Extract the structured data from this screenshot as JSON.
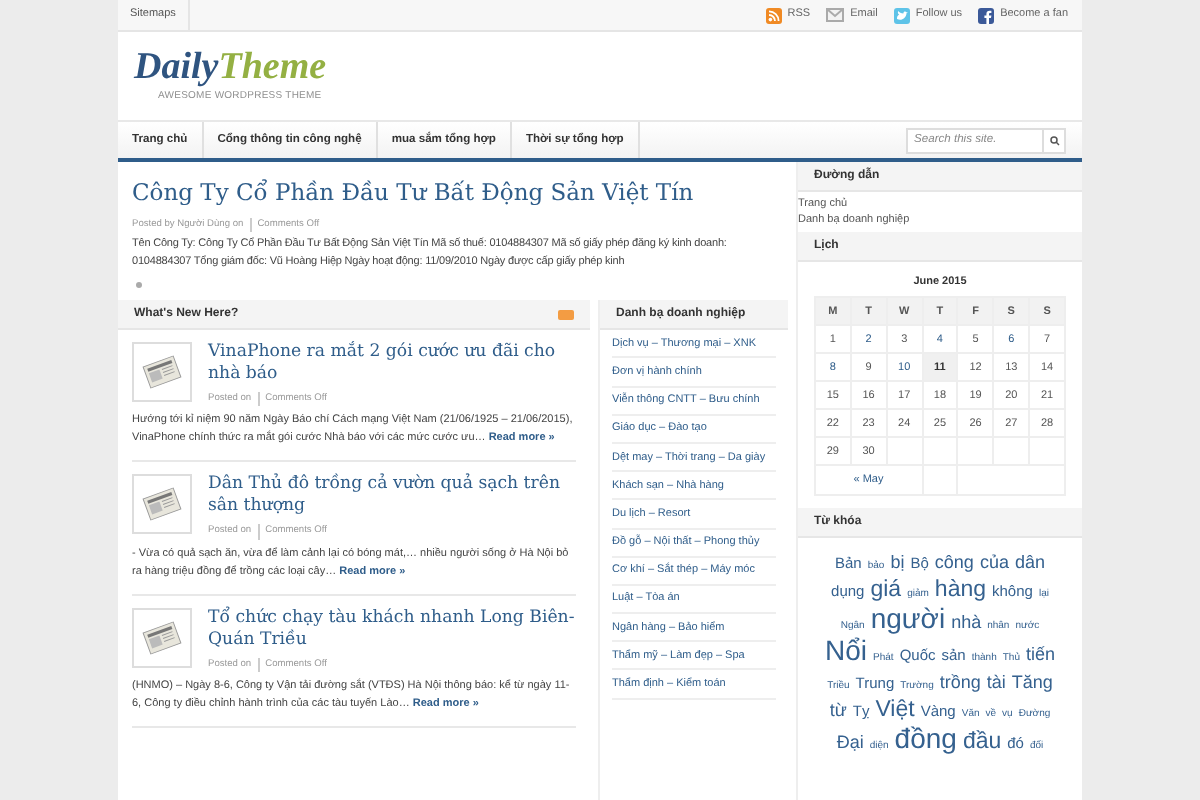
{
  "top_bar": {
    "sitemap": "Sitemaps",
    "social": [
      {
        "kind": "rss",
        "label": "RSS"
      },
      {
        "kind": "email",
        "label": "Email"
      },
      {
        "kind": "twitter",
        "label": "Follow us"
      },
      {
        "kind": "facebook",
        "label": "Become a fan"
      }
    ]
  },
  "logo": {
    "first": "Daily",
    "second": "Theme",
    "tagline": "AWESOME WORDPRESS THEME"
  },
  "nav": {
    "items": [
      "Trang chủ",
      "Cổng thông tin công nghệ",
      "mua sắm tổng hợp",
      "Thời sự tổng hợp"
    ],
    "search_placeholder": "Search this site."
  },
  "post": {
    "title": "Công Ty Cổ Phần Đầu Tư Bất Động Sản Việt Tín",
    "meta": [
      "Posted by Người Dùng on",
      "Comments Off"
    ],
    "body": "Tên Công Ty: Công Ty Cổ Phần Đầu Tư Bất Động Sản Việt Tín Mã số thuế:  0104884307   Mã số giấy phép đăng ký kinh doanh: 0104884307 Tổng giám đốc: Vũ Hoàng Hiệp Ngày hoạt động: 11/09/2010 Ngày được cấp giấy phép kinh"
  },
  "whats_new": {
    "title": "What's New Here?",
    "items": [
      {
        "title": "VinaPhone ra mắt 2 gói cước ưu đãi cho nhà báo",
        "meta": [
          "Posted on",
          "Comments Off"
        ],
        "excerpt": "Hướng tới kỉ niệm 90 năm Ngày Báo chí Cách mạng Việt Nam (21/06/1925 – 21/06/2015), VinaPhone chính thức ra mắt gói cước Nhà báo với các mức cước ưu…",
        "more": "Read more »"
      },
      {
        "title": "Dân Thủ đô trồng cả vườn quả sạch trên sân thượng",
        "meta": [
          "Posted on",
          "Comments Off"
        ],
        "excerpt": "- Vừa có quả sạch ăn, vừa để làm cảnh lại có bóng mát,… nhiều người sống ở Hà Nội bỏ ra hàng triệu đồng để trồng các loại cây…",
        "more": "Read more »"
      },
      {
        "title": "Tổ chức chạy tàu khách nhanh Long Biên-Quán Triều",
        "meta": [
          "Posted on",
          "Comments Off"
        ],
        "excerpt": "(HNMO) – Ngày 8-6, Công ty Vận tải đường sắt (VTĐS) Hà Nội thông báo: kể từ ngày 11-6, Công ty điều chỉnh hành trình của các tàu tuyến Lào…",
        "more": "Read more »"
      }
    ]
  },
  "directory": {
    "title": "Danh bạ doanh nghiệp",
    "items": [
      "Dịch vụ – Thương mại – XNK",
      "Đơn vị hành chính",
      "Viễn thông CNTT – Bưu chính",
      "Giáo dục – Đào tạo",
      "Dệt may – Thời trang – Da giày",
      "Khách sạn – Nhà hàng",
      "Du lịch – Resort",
      "Đồ gỗ – Nội thất – Phong thủy",
      "Cơ khí – Sắt thép – Máy móc",
      "Luật – Tòa án",
      "Ngân hàng – Bảo hiểm",
      "Thẩm mỹ – Làm đẹp – Spa",
      "Thẩm định – Kiểm toán"
    ]
  },
  "breadcrumb": {
    "title": "Đường dẫn",
    "items": [
      "Trang chủ",
      "Danh bạ doanh nghiệp"
    ]
  },
  "calendar": {
    "title": "Lịch",
    "month": "June 2015",
    "weekdays": [
      "M",
      "T",
      "W",
      "T",
      "F",
      "S",
      "S"
    ],
    "weeks": [
      [
        {
          "day": "1",
          "linked": false,
          "today": false
        },
        {
          "day": "2",
          "linked": true,
          "today": false
        },
        {
          "day": "3",
          "linked": false,
          "today": false
        },
        {
          "day": "4",
          "linked": true,
          "today": false
        },
        {
          "day": "5",
          "linked": false,
          "today": false
        },
        {
          "day": "6",
          "linked": true,
          "today": false
        },
        {
          "day": "7",
          "linked": false,
          "today": false
        }
      ],
      [
        {
          "day": "8",
          "linked": true,
          "today": false
        },
        {
          "day": "9",
          "linked": false,
          "today": false
        },
        {
          "day": "10",
          "linked": true,
          "today": false
        },
        {
          "day": "11",
          "linked": false,
          "today": true
        },
        {
          "day": "12",
          "linked": false,
          "today": false
        },
        {
          "day": "13",
          "linked": false,
          "today": false
        },
        {
          "day": "14",
          "linked": false,
          "today": false
        }
      ],
      [
        {
          "day": "15",
          "linked": false,
          "today": false
        },
        {
          "day": "16",
          "linked": false,
          "today": false
        },
        {
          "day": "17",
          "linked": false,
          "today": false
        },
        {
          "day": "18",
          "linked": false,
          "today": false
        },
        {
          "day": "19",
          "linked": false,
          "today": false
        },
        {
          "day": "20",
          "linked": false,
          "today": false
        },
        {
          "day": "21",
          "linked": false,
          "today": false
        }
      ],
      [
        {
          "day": "22",
          "linked": false,
          "today": false
        },
        {
          "day": "23",
          "linked": false,
          "today": false
        },
        {
          "day": "24",
          "linked": false,
          "today": false
        },
        {
          "day": "25",
          "linked": false,
          "today": false
        },
        {
          "day": "26",
          "linked": false,
          "today": false
        },
        {
          "day": "27",
          "linked": false,
          "today": false
        },
        {
          "day": "28",
          "linked": false,
          "today": false
        }
      ],
      [
        {
          "day": "29",
          "linked": false,
          "today": false
        },
        {
          "day": "30",
          "linked": false,
          "today": false
        }
      ]
    ],
    "prev": "« May"
  },
  "tags": {
    "title": "Từ khóa",
    "items": [
      {
        "text": "Bản",
        "kind": "s"
      },
      {
        "text": "bảo",
        "kind": "xs"
      },
      {
        "text": "bị",
        "kind": "m"
      },
      {
        "text": "Bộ",
        "kind": "s"
      },
      {
        "text": "công",
        "kind": "m"
      },
      {
        "text": "của",
        "kind": "m"
      },
      {
        "text": "dân",
        "kind": "m"
      },
      {
        "text": "dụng",
        "kind": "s"
      },
      {
        "text": "giá",
        "kind": "l"
      },
      {
        "text": "giảm",
        "kind": "xs"
      },
      {
        "text": "hàng",
        "kind": "l"
      },
      {
        "text": "không",
        "kind": "s"
      },
      {
        "text": "lại",
        "kind": "xs"
      },
      {
        "text": "Ngân",
        "kind": "xs"
      },
      {
        "text": "người",
        "kind": "xl"
      },
      {
        "text": "nhà",
        "kind": "m"
      },
      {
        "text": "nhân",
        "kind": "xs"
      },
      {
        "text": "nước",
        "kind": "xs"
      },
      {
        "text": "Nổi",
        "kind": "xl"
      },
      {
        "text": "Phát",
        "kind": "xs"
      },
      {
        "text": "Quốc",
        "kind": "s"
      },
      {
        "text": "sản",
        "kind": "s"
      },
      {
        "text": "thành",
        "kind": "xs"
      },
      {
        "text": "Thủ",
        "kind": "xs"
      },
      {
        "text": "tiến",
        "kind": "m"
      },
      {
        "text": "Triều",
        "kind": "xs"
      },
      {
        "text": "Trung",
        "kind": "s"
      },
      {
        "text": "Trường",
        "kind": "xs"
      },
      {
        "text": "trồng",
        "kind": "m"
      },
      {
        "text": "tài",
        "kind": "m"
      },
      {
        "text": "Tăng",
        "kind": "m"
      },
      {
        "text": "từ",
        "kind": "m"
      },
      {
        "text": "Tỵ",
        "kind": "s"
      },
      {
        "text": "Việt",
        "kind": "l"
      },
      {
        "text": "Vàng",
        "kind": "s"
      },
      {
        "text": "Văn",
        "kind": "xs"
      },
      {
        "text": "về",
        "kind": "xs"
      },
      {
        "text": "vụ",
        "kind": "xs"
      },
      {
        "text": "Đường",
        "kind": "xs"
      },
      {
        "text": "Đại",
        "kind": "m"
      },
      {
        "text": "diện",
        "kind": "xs"
      },
      {
        "text": "đồng",
        "kind": "xl"
      },
      {
        "text": "đầu",
        "kind": "l"
      },
      {
        "text": "đó",
        "kind": "s"
      },
      {
        "text": "đối",
        "kind": "xs"
      }
    ]
  }
}
